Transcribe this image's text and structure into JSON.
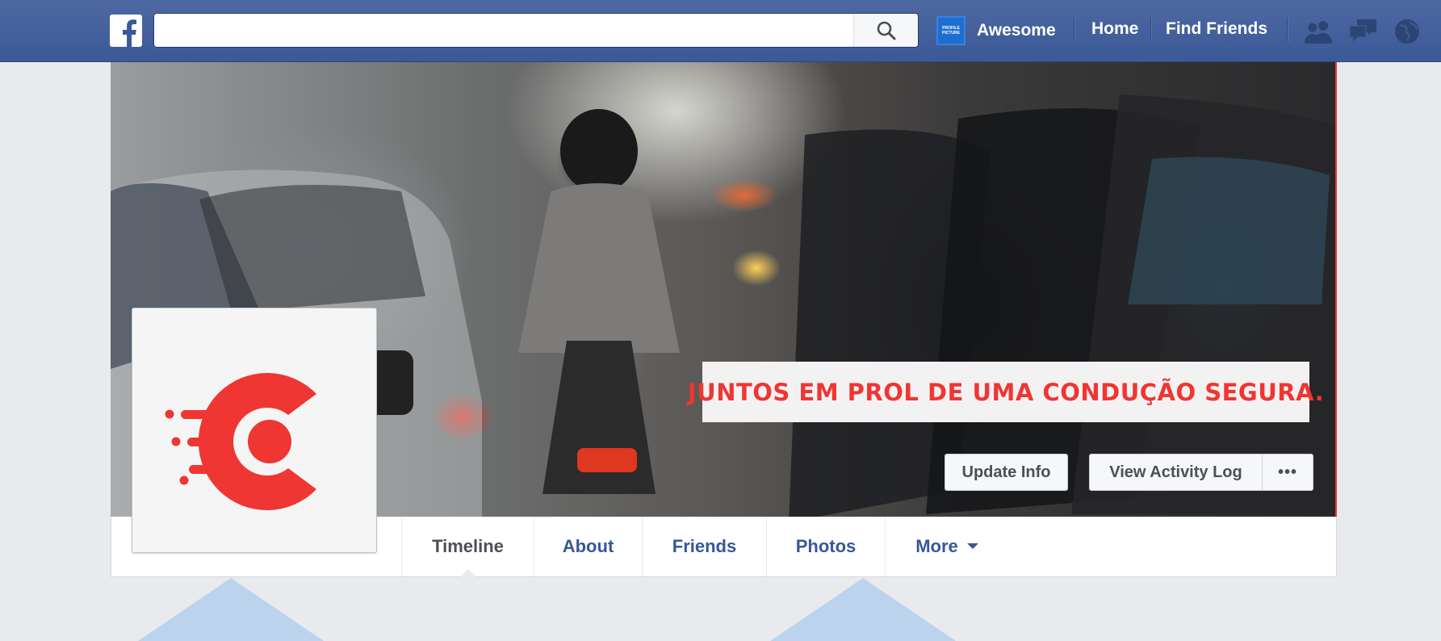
{
  "topbar": {
    "search_placeholder": "",
    "avatar_text_line1": "PROFILE",
    "avatar_text_line2": "PICTURE",
    "profile_name": "Awesome",
    "links": [
      "Home",
      "Find Friends"
    ],
    "icons": [
      "friend-requests-icon",
      "messages-icon",
      "notifications-globe-icon"
    ],
    "bar_color": "#3b5998"
  },
  "cover": {
    "banner_text": "JUNTOS EM PROL DE UMA CONDUÇÃO SEGURA.",
    "banner_color": "#ef3633",
    "buttons": {
      "update_info": "Update Info",
      "view_activity_log": "View Activity Log",
      "more_actions": "•••"
    }
  },
  "profile_nav": {
    "tabs": [
      "Timeline",
      "About",
      "Friends",
      "Photos",
      "More"
    ],
    "active_tab": "Timeline"
  },
  "profile_picture": {
    "logo_color": "#ef3633"
  }
}
